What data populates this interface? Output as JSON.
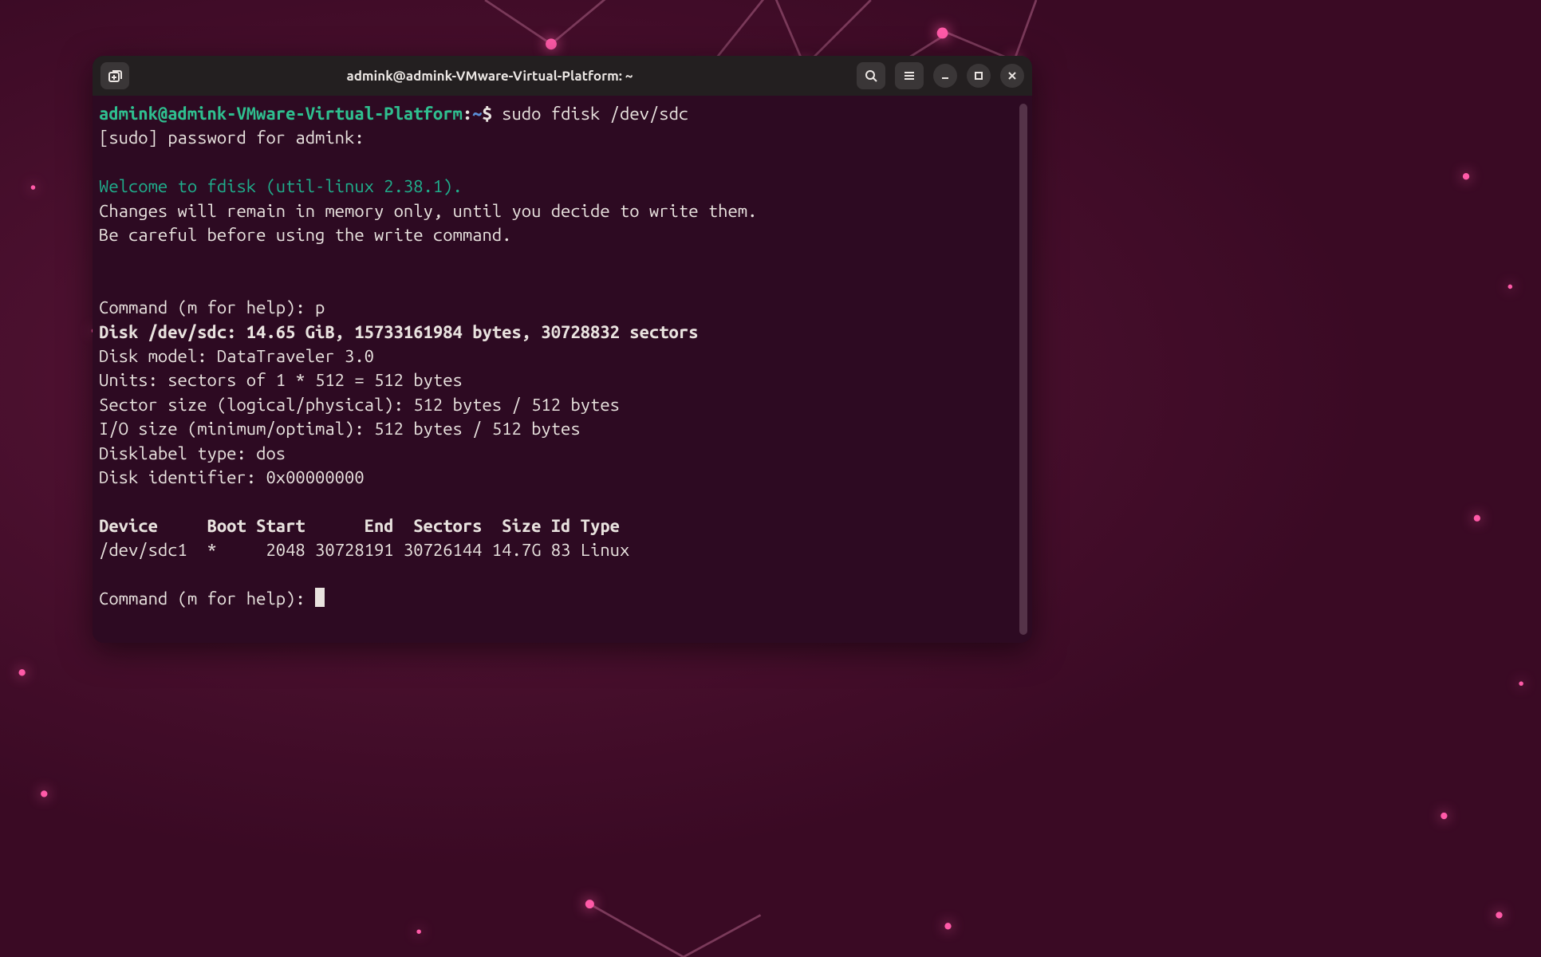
{
  "colors": {
    "window_bg": "#2d0a22",
    "titlebar_bg": "#231f20",
    "text": "#e9e3df",
    "prompt_user": "#2fbf8f",
    "prompt_path": "#5a8ed6",
    "welcome": "#1fae8c",
    "desktop_bg": "#4a0e2e"
  },
  "titlebar": {
    "title": "admink@admink-VMware-Virtual-Platform: ~",
    "icons": {
      "new_tab": "new-tab-icon",
      "search": "search-icon",
      "menu": "hamburger-icon",
      "minimize": "minimize-icon",
      "maximize": "maximize-icon",
      "close": "close-icon"
    }
  },
  "terminal": {
    "prompt": {
      "user_host": "admink@admink-VMware-Virtual-Platform",
      "path": "~",
      "separator": ":",
      "sigil": "$"
    },
    "command": "sudo fdisk /dev/sdc",
    "sudo_prompt": "[sudo] password for admink:",
    "welcome": "Welcome to fdisk (util-linux 2.38.1).",
    "note1": "Changes will remain in memory only, until you decide to write them.",
    "note2": "Be careful before using the write command.",
    "cmd_help1": "Command (m for help): p",
    "disk_line": "Disk /dev/sdc: 14.65 GiB, 15733161984 bytes, 30728832 sectors",
    "disk_model": "Disk model: DataTraveler 3.0",
    "units": "Units: sectors of 1 * 512 = 512 bytes",
    "sector_size": "Sector size (logical/physical): 512 bytes / 512 bytes",
    "io_size": "I/O size (minimum/optimal): 512 bytes / 512 bytes",
    "disklabel": "Disklabel type: dos",
    "disk_id": "Disk identifier: 0x00000000",
    "table_header": "Device     Boot Start      End  Sectors  Size Id Type",
    "table_row": "/dev/sdc1  *     2048 30728191 30726144 14.7G 83 Linux",
    "cmd_help2": "Command (m for help): ",
    "partition": {
      "device": "/dev/sdc1",
      "boot": "*",
      "start": 2048,
      "end": 30728191,
      "sectors": 30726144,
      "size": "14.7G",
      "id": "83",
      "type": "Linux"
    }
  }
}
